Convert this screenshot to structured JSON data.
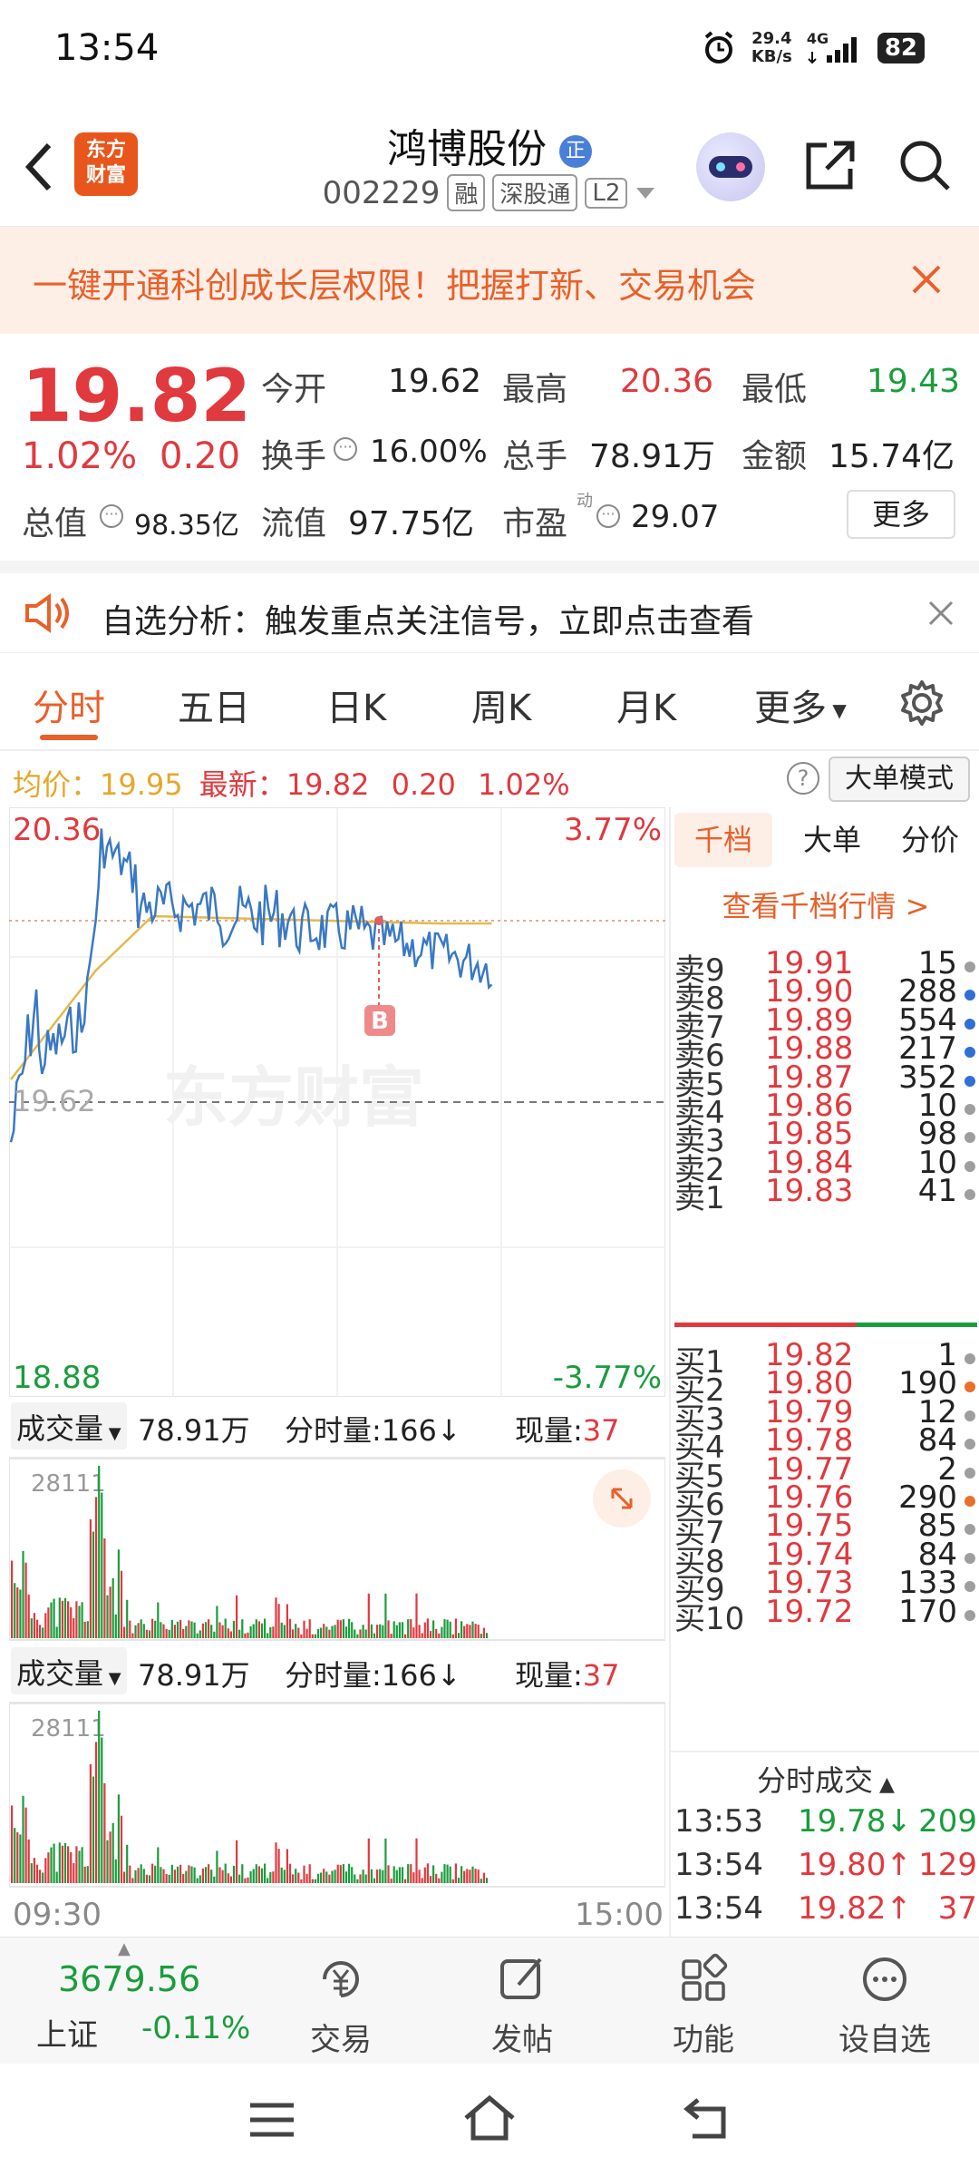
{
  "status": {
    "time": "13:54",
    "net_speed_top": "29.4",
    "net_speed_bottom": "KB/s",
    "network": "4G",
    "battery": "82"
  },
  "header": {
    "stock_name": "鸿博股份",
    "badge": "正",
    "code": "002229",
    "tags": [
      "融",
      "深股通",
      "L2"
    ],
    "logo_line1": "东方",
    "logo_line2": "财富"
  },
  "banner": {
    "text": "一键开通科创成长层权限！把握打新、交易机会"
  },
  "quote": {
    "price": "19.82",
    "change_pct": "1.02%",
    "change": "0.20",
    "open_label": "今开",
    "open": "19.62",
    "high_label": "最高",
    "high": "20.36",
    "low_label": "最低",
    "low": "19.43",
    "turnover_label": "换手",
    "turnover": "16.00%",
    "volume_label": "总手",
    "volume": "78.91万",
    "amount_label": "金额",
    "amount": "15.74亿",
    "mktcap_label": "总值",
    "mktcap": "98.35亿",
    "float_label": "流值",
    "float_cap": "97.75亿",
    "pe_label": "市盈",
    "pe_sup": "动",
    "pe": "29.07",
    "more_button": "更多"
  },
  "notice": {
    "text": "自选分析：触发重点关注信号，立即点击查看"
  },
  "tabs": [
    "分时",
    "五日",
    "日K",
    "周K",
    "月K",
    "更多"
  ],
  "infoline": {
    "avg_label": "均价：",
    "avg": "19.95",
    "latest_label": "最新：",
    "latest": "19.82",
    "change": "0.20",
    "change_pct": "1.02%",
    "mode_button": "大单模式"
  },
  "chart": {
    "top_price": "20.36",
    "top_pct": "3.77%",
    "mid_price": "19.62",
    "bottom_price": "18.88",
    "bottom_pct": "-3.77%",
    "watermark": "东方财富",
    "marker": "B",
    "time_start": "09:30",
    "time_end": "15:00"
  },
  "volume_panel": {
    "label": "成交量",
    "total": "78.91万",
    "fen_label": "分时量:",
    "fen_value": "166",
    "fen_arrow": "↓",
    "now_label": "现量:",
    "now_value": "37",
    "max_label": "28111"
  },
  "orderbook": {
    "tabs": [
      "千档",
      "大单",
      "分价"
    ],
    "link": "查看千档行情 >",
    "asks": [
      {
        "label": "卖9",
        "price": "19.91",
        "vol": "15",
        "dot": "#9e9e9e"
      },
      {
        "label": "卖8",
        "price": "19.90",
        "vol": "288",
        "dot": "#2f6fd6"
      },
      {
        "label": "卖7",
        "price": "19.89",
        "vol": "554",
        "dot": "#2f6fd6"
      },
      {
        "label": "卖6",
        "price": "19.88",
        "vol": "217",
        "dot": "#2f6fd6"
      },
      {
        "label": "卖5",
        "price": "19.87",
        "vol": "352",
        "dot": "#2f6fd6"
      },
      {
        "label": "卖4",
        "price": "19.86",
        "vol": "10",
        "dot": "#9e9e9e"
      },
      {
        "label": "卖3",
        "price": "19.85",
        "vol": "98",
        "dot": "#9e9e9e"
      },
      {
        "label": "卖2",
        "price": "19.84",
        "vol": "10",
        "dot": "#9e9e9e"
      },
      {
        "label": "卖1",
        "price": "19.83",
        "vol": "41",
        "dot": "#9e9e9e"
      }
    ],
    "bids": [
      {
        "label": "买1",
        "price": "19.82",
        "vol": "1",
        "dot": "#9e9e9e"
      },
      {
        "label": "买2",
        "price": "19.80",
        "vol": "190",
        "dot": "#e8702a"
      },
      {
        "label": "买3",
        "price": "19.79",
        "vol": "12",
        "dot": "#9e9e9e"
      },
      {
        "label": "买4",
        "price": "19.78",
        "vol": "84",
        "dot": "#9e9e9e"
      },
      {
        "label": "买5",
        "price": "19.77",
        "vol": "2",
        "dot": "#9e9e9e"
      },
      {
        "label": "买6",
        "price": "19.76",
        "vol": "290",
        "dot": "#e8702a"
      },
      {
        "label": "买7",
        "price": "19.75",
        "vol": "85",
        "dot": "#9e9e9e"
      },
      {
        "label": "买8",
        "price": "19.74",
        "vol": "84",
        "dot": "#9e9e9e"
      },
      {
        "label": "买9",
        "price": "19.73",
        "vol": "133",
        "dot": "#9e9e9e"
      },
      {
        "label": "买10",
        "price": "19.72",
        "vol": "170",
        "dot": "#9e9e9e"
      }
    ],
    "ticks_title": "分时成交",
    "ticks": [
      {
        "time": "13:53",
        "price": "19.78",
        "dir": "↓",
        "vol": "209",
        "color": "#1a9d3c"
      },
      {
        "time": "13:54",
        "price": "19.80",
        "dir": "↑",
        "vol": "129",
        "color": "#e0393e"
      },
      {
        "time": "13:54",
        "price": "19.82",
        "dir": "↑",
        "vol": "37",
        "color": "#e0393e"
      }
    ]
  },
  "bottomnav": {
    "index_value": "3679.56",
    "index_name": "上证",
    "index_change": "-0.11%",
    "items": [
      "交易",
      "发帖",
      "功能",
      "设自选"
    ]
  },
  "colors": {
    "up": "#e0393e",
    "down": "#1a9d3c",
    "accent": "#e8602a",
    "price_line": "#3a78c4",
    "avg_line": "#e6b84a"
  }
}
